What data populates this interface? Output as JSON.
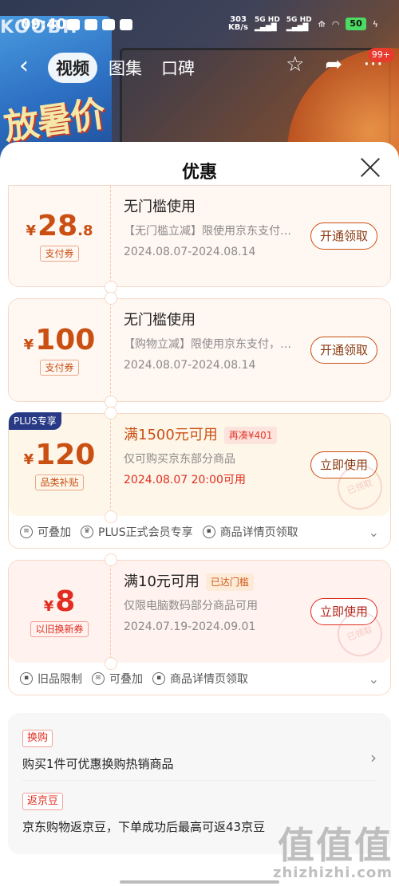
{
  "status_bar": {
    "time": "09:40",
    "network_speed_value": "303",
    "network_speed_unit": "KB/s",
    "signal_1": "5G HD",
    "signal_2": "5G HD",
    "battery": "50"
  },
  "background": {
    "brand_text": "KOOBII",
    "art_text": "放暑价"
  },
  "nav": {
    "tabs": [
      {
        "label": "视频",
        "active": true
      },
      {
        "label": "图集",
        "active": false
      },
      {
        "label": "口碑",
        "active": false
      }
    ],
    "message_badge": "99+"
  },
  "sheet": {
    "title": "优惠"
  },
  "coupons": [
    {
      "amount_int": "28",
      "amount_dec": ".8",
      "tag": "支付券",
      "condition": "无门槛使用",
      "description": "【无门槛立减】限使用京东支付，部分商品",
      "date": "2024.08.07-2024.08.14",
      "action": "开通领取"
    },
    {
      "amount_int": "100",
      "tag": "支付券",
      "condition": "无门槛使用",
      "description": "【购物立减】限使用京东支付，部分商品",
      "date": "2024.08.07-2024.08.14",
      "action": "开通领取"
    },
    {
      "plus_label": "PLUS专享",
      "amount_int": "120",
      "tag": "品类补贴",
      "condition": "满1500元可用",
      "chip": "再凑¥401",
      "description": "仅可购买京东部分商品",
      "date": "2024.08.07 20:00可用",
      "action": "立即使用",
      "stamp": "已领取",
      "footer": [
        {
          "icon": "stack-icon",
          "label": "可叠加"
        },
        {
          "icon": "crown-icon",
          "label": "PLUS正式会员专享"
        },
        {
          "icon": "coupon-small-icon",
          "label": "商品详情页领取"
        }
      ]
    },
    {
      "amount_int": "8",
      "tag": "以旧换新券",
      "condition": "满10元可用",
      "chip": "已达门槛",
      "description": "仅限电脑数码部分商品可用",
      "date": "2024.07.19-2024.09.01",
      "action": "立即使用",
      "stamp": "已领取",
      "footer": [
        {
          "icon": "coupon-small-icon",
          "label": "旧品限制"
        },
        {
          "icon": "stack-icon",
          "label": "可叠加"
        },
        {
          "icon": "coupon-small-icon",
          "label": "商品详情页领取"
        }
      ]
    }
  ],
  "currency_symbol": "¥",
  "promos": [
    {
      "tag": "换购",
      "text": "购买1件可优惠换购热销商品"
    },
    {
      "tag": "返京豆",
      "text": "京东购物返京豆，下单成功后最高可返43京豆"
    }
  ],
  "watermark": {
    "big": "值值值",
    "small": "zhizhizhi.com"
  },
  "colors": {
    "accent_orange": "#c94f12",
    "accent_red": "#e12d1f",
    "plus_blue": "#283a86"
  }
}
